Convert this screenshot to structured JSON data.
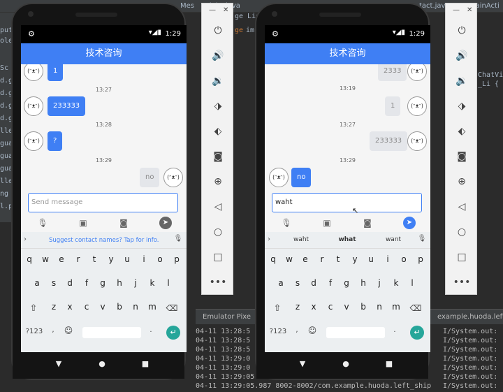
{
  "ide": {
    "tabs": [
      "Mes",
      "tivity.java",
      "tact.java",
      "MainActi"
    ],
    "left_fragments": [
      "put",
      "oleu",
      "Sc",
      "d.g",
      "d.g",
      "d.g",
      "d.g",
      "lle-",
      "gua",
      "gua",
      "gua",
      "lle.",
      "ng",
      "l.pr"
    ],
    "code_lines_left": [
      "ge",
      "im"
    ],
    "code_lines_mid": [
      "ge Lis",
      "ChatVi",
      "_Li",
      "{"
    ],
    "console_title": "Emulator Pixe",
    "console_title_right": "example.huoda.left",
    "console_lines": [
      {
        "l": "04-11 13:28:5",
        "r": "I/System.out:"
      },
      {
        "l": "04-11 13:28:5",
        "r": "I/System.out:"
      },
      {
        "l": "04-11 13:28:5",
        "r": "I/System.out:"
      },
      {
        "l": "04-11 13:29:0",
        "r": "I/System.out:"
      },
      {
        "l": "04-11 13:29:0",
        "r": "I/System.out:"
      },
      {
        "l": "04-11 13:29:05",
        "r": "I/System.out:"
      },
      {
        "l": "04-11 13:29:05.987 8002-8002/com.example.huoda.left_ship",
        "r": "I/System.out:"
      }
    ]
  },
  "phones": {
    "left": {
      "status_time": "1:29",
      "title": "技术咨询",
      "messages": [
        {
          "type": "in",
          "text": "1"
        },
        {
          "type": "time",
          "text": "13:27"
        },
        {
          "type": "in",
          "text": "233333"
        },
        {
          "type": "time",
          "text": "13:28"
        },
        {
          "type": "in",
          "text": "?"
        },
        {
          "type": "time",
          "text": "13:29"
        },
        {
          "type": "out",
          "text": "no"
        }
      ],
      "input_placeholder": "Send message",
      "suggest": "Suggest contact names? Tap for info."
    },
    "right": {
      "status_time": "1:29",
      "title": "技术咨询",
      "messages": [
        {
          "type": "out",
          "text": "2333"
        },
        {
          "type": "time",
          "text": "13:19"
        },
        {
          "type": "out",
          "text": "1"
        },
        {
          "type": "time",
          "text": "13:27"
        },
        {
          "type": "out",
          "text": "233333"
        },
        {
          "type": "time",
          "text": "13:29"
        },
        {
          "type": "in",
          "text": "no"
        }
      ],
      "input_value": "waht",
      "suggestions": [
        "waht",
        "what",
        "want"
      ]
    }
  },
  "avatar_label": "(ᵔᴥᵔ)",
  "keyboard": {
    "row1": [
      "q",
      "w",
      "e",
      "r",
      "t",
      "y",
      "u",
      "i",
      "o",
      "p"
    ],
    "row1_sup": [
      "1",
      "2",
      "3",
      "4",
      "5",
      "6",
      "7",
      "8",
      "9",
      "0"
    ],
    "row2": [
      "a",
      "s",
      "d",
      "f",
      "g",
      "h",
      "j",
      "k",
      "l"
    ],
    "row3": [
      "z",
      "x",
      "c",
      "v",
      "b",
      "n",
      "m"
    ],
    "sym": "?123",
    "comma": ",",
    "period": "."
  },
  "icons": {
    "gear": "gear-icon",
    "mic": "mic-icon",
    "image": "image-icon",
    "camera": "camera-icon",
    "send": "send-icon",
    "shift": "shift-icon",
    "backspace": "backspace-icon",
    "emoji": "emoji-icon",
    "enter": "enter-icon"
  },
  "colors": {
    "accent": "#3f7ff4",
    "enter": "#26a69a"
  }
}
